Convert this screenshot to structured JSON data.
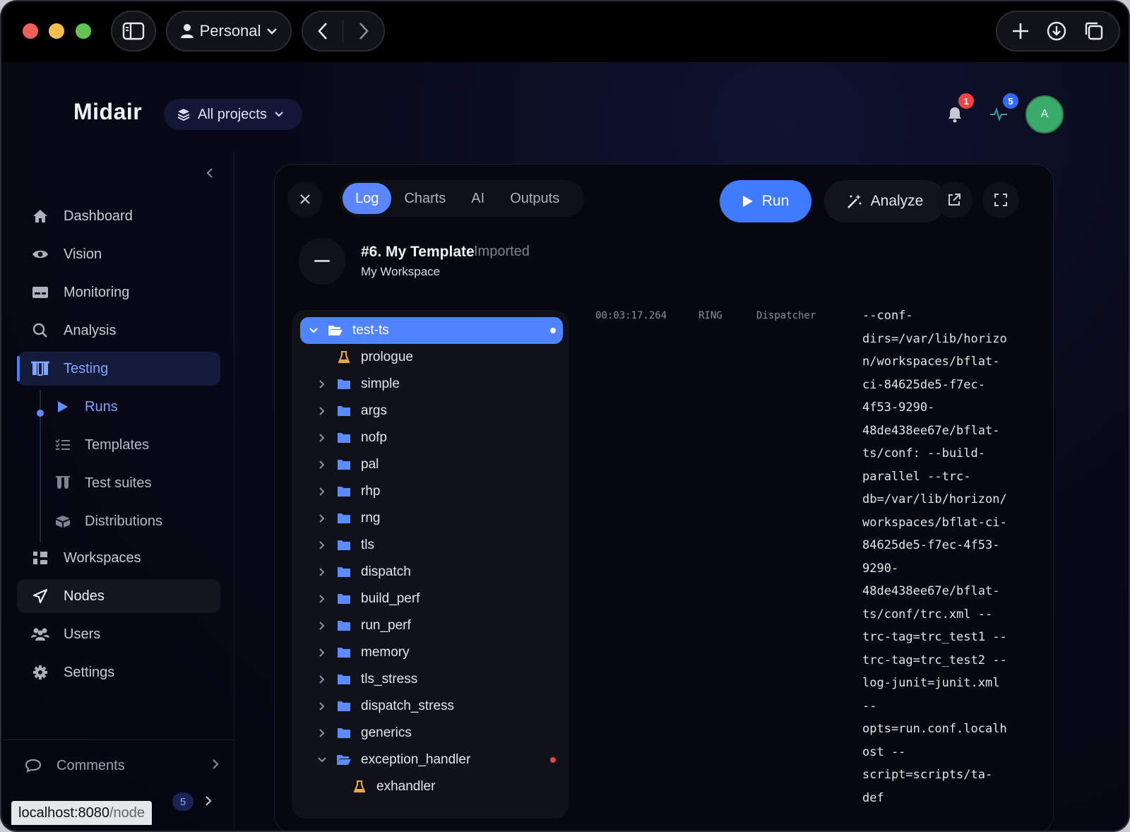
{
  "browser": {
    "profile_label": "Personal",
    "status_url_host": "localhost:8080",
    "status_url_path": "/node",
    "icons": [
      "sidebar-toggle-icon",
      "user-icon",
      "chevron-down-icon",
      "back-arrow-icon",
      "forward-arrow-icon",
      "plus-icon",
      "download-icon",
      "tabs-icon"
    ]
  },
  "header": {
    "brand": "Midair",
    "projects_label": "All projects",
    "notifications_count": "1",
    "activity_count": "5",
    "avatar_initial": "A"
  },
  "sidebar": {
    "items": [
      {
        "label": "Dashboard",
        "icon": "home-icon"
      },
      {
        "label": "Vision",
        "icon": "eye-icon"
      },
      {
        "label": "Monitoring",
        "icon": "monitor-icon"
      },
      {
        "label": "Analysis",
        "icon": "search-icon"
      },
      {
        "label": "Testing",
        "icon": "flask-icon"
      },
      {
        "label": "Workspaces",
        "icon": "workspaces-icon"
      },
      {
        "label": "Nodes",
        "icon": "send-icon"
      },
      {
        "label": "Users",
        "icon": "users-icon"
      },
      {
        "label": "Settings",
        "icon": "gear-icon"
      }
    ],
    "testing_subitems": [
      {
        "label": "Runs",
        "icon": "play-icon"
      },
      {
        "label": "Templates",
        "icon": "checklist-icon"
      },
      {
        "label": "Test suites",
        "icon": "test-tubes-icon"
      },
      {
        "label": "Distributions",
        "icon": "box-icon"
      }
    ],
    "comments_label": "Comments",
    "bottom_count": "5"
  },
  "panel": {
    "tabs": [
      "Log",
      "Charts",
      "AI",
      "Outputs"
    ],
    "active_tab": "Log",
    "run_label": "Run",
    "analyze_label": "Analyze",
    "record": {
      "title": "#6. My Template",
      "status": "Imported",
      "workspace": "My Workspace"
    },
    "tree": {
      "root": "test-ts",
      "items": [
        {
          "label": "prologue",
          "type": "test"
        },
        {
          "label": "simple",
          "type": "folder"
        },
        {
          "label": "args",
          "type": "folder"
        },
        {
          "label": "nofp",
          "type": "folder"
        },
        {
          "label": "pal",
          "type": "folder"
        },
        {
          "label": "rhp",
          "type": "folder"
        },
        {
          "label": "rng",
          "type": "folder"
        },
        {
          "label": "tls",
          "type": "folder"
        },
        {
          "label": "dispatch",
          "type": "folder"
        },
        {
          "label": "build_perf",
          "type": "folder"
        },
        {
          "label": "run_perf",
          "type": "folder"
        },
        {
          "label": "memory",
          "type": "folder"
        },
        {
          "label": "tls_stress",
          "type": "folder"
        },
        {
          "label": "dispatch_stress",
          "type": "folder"
        },
        {
          "label": "generics",
          "type": "folder"
        },
        {
          "label": "exception_handler",
          "type": "folder-open"
        },
        {
          "label": "exhandler",
          "type": "test"
        }
      ],
      "status_colors": {
        "selected_dot": "#ffffff",
        "error_dot": "#ef4444"
      }
    },
    "log": {
      "timestamp": "00:03:17.264",
      "level": "RING",
      "source": "Dispatcher",
      "message_lines": [
        "--conf-",
        "dirs=/var/lib/horizo",
        "n/workspaces/bflat-",
        "ci-84625de5-f7ec-",
        "4f53-9290-",
        "48de438ee67e/bflat-",
        "ts/conf: --build-",
        "parallel --trc-",
        "db=/var/lib/horizon/",
        "workspaces/bflat-ci-",
        "84625de5-f7ec-4f53-",
        "9290-",
        "48de438ee67e/bflat-",
        "ts/conf/trc.xml --",
        "trc-tag=trc_test1 --",
        "trc-tag=trc_test2 --",
        "log-junit=junit.xml",
        "--",
        "opts=run.conf.localh",
        "ost --",
        "script=scripts/ta-",
        "def"
      ]
    }
  },
  "colors": {
    "accent": "#4f83ff",
    "run_button": "#3f7bff",
    "avatar": "#3bab6a",
    "notification_badge": "#ef4444",
    "activity_badge": "#2f6bff"
  }
}
